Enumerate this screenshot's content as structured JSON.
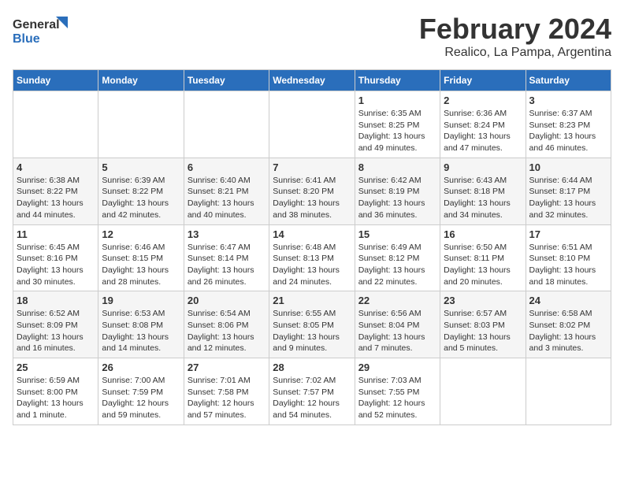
{
  "logo": {
    "line1": "General",
    "line2": "Blue"
  },
  "title": "February 2024",
  "subtitle": "Realico, La Pampa, Argentina",
  "weekdays": [
    "Sunday",
    "Monday",
    "Tuesday",
    "Wednesday",
    "Thursday",
    "Friday",
    "Saturday"
  ],
  "weeks": [
    [
      {
        "num": "",
        "info": ""
      },
      {
        "num": "",
        "info": ""
      },
      {
        "num": "",
        "info": ""
      },
      {
        "num": "",
        "info": ""
      },
      {
        "num": "1",
        "info": "Sunrise: 6:35 AM\nSunset: 8:25 PM\nDaylight: 13 hours\nand 49 minutes."
      },
      {
        "num": "2",
        "info": "Sunrise: 6:36 AM\nSunset: 8:24 PM\nDaylight: 13 hours\nand 47 minutes."
      },
      {
        "num": "3",
        "info": "Sunrise: 6:37 AM\nSunset: 8:23 PM\nDaylight: 13 hours\nand 46 minutes."
      }
    ],
    [
      {
        "num": "4",
        "info": "Sunrise: 6:38 AM\nSunset: 8:22 PM\nDaylight: 13 hours\nand 44 minutes."
      },
      {
        "num": "5",
        "info": "Sunrise: 6:39 AM\nSunset: 8:22 PM\nDaylight: 13 hours\nand 42 minutes."
      },
      {
        "num": "6",
        "info": "Sunrise: 6:40 AM\nSunset: 8:21 PM\nDaylight: 13 hours\nand 40 minutes."
      },
      {
        "num": "7",
        "info": "Sunrise: 6:41 AM\nSunset: 8:20 PM\nDaylight: 13 hours\nand 38 minutes."
      },
      {
        "num": "8",
        "info": "Sunrise: 6:42 AM\nSunset: 8:19 PM\nDaylight: 13 hours\nand 36 minutes."
      },
      {
        "num": "9",
        "info": "Sunrise: 6:43 AM\nSunset: 8:18 PM\nDaylight: 13 hours\nand 34 minutes."
      },
      {
        "num": "10",
        "info": "Sunrise: 6:44 AM\nSunset: 8:17 PM\nDaylight: 13 hours\nand 32 minutes."
      }
    ],
    [
      {
        "num": "11",
        "info": "Sunrise: 6:45 AM\nSunset: 8:16 PM\nDaylight: 13 hours\nand 30 minutes."
      },
      {
        "num": "12",
        "info": "Sunrise: 6:46 AM\nSunset: 8:15 PM\nDaylight: 13 hours\nand 28 minutes."
      },
      {
        "num": "13",
        "info": "Sunrise: 6:47 AM\nSunset: 8:14 PM\nDaylight: 13 hours\nand 26 minutes."
      },
      {
        "num": "14",
        "info": "Sunrise: 6:48 AM\nSunset: 8:13 PM\nDaylight: 13 hours\nand 24 minutes."
      },
      {
        "num": "15",
        "info": "Sunrise: 6:49 AM\nSunset: 8:12 PM\nDaylight: 13 hours\nand 22 minutes."
      },
      {
        "num": "16",
        "info": "Sunrise: 6:50 AM\nSunset: 8:11 PM\nDaylight: 13 hours\nand 20 minutes."
      },
      {
        "num": "17",
        "info": "Sunrise: 6:51 AM\nSunset: 8:10 PM\nDaylight: 13 hours\nand 18 minutes."
      }
    ],
    [
      {
        "num": "18",
        "info": "Sunrise: 6:52 AM\nSunset: 8:09 PM\nDaylight: 13 hours\nand 16 minutes."
      },
      {
        "num": "19",
        "info": "Sunrise: 6:53 AM\nSunset: 8:08 PM\nDaylight: 13 hours\nand 14 minutes."
      },
      {
        "num": "20",
        "info": "Sunrise: 6:54 AM\nSunset: 8:06 PM\nDaylight: 13 hours\nand 12 minutes."
      },
      {
        "num": "21",
        "info": "Sunrise: 6:55 AM\nSunset: 8:05 PM\nDaylight: 13 hours\nand 9 minutes."
      },
      {
        "num": "22",
        "info": "Sunrise: 6:56 AM\nSunset: 8:04 PM\nDaylight: 13 hours\nand 7 minutes."
      },
      {
        "num": "23",
        "info": "Sunrise: 6:57 AM\nSunset: 8:03 PM\nDaylight: 13 hours\nand 5 minutes."
      },
      {
        "num": "24",
        "info": "Sunrise: 6:58 AM\nSunset: 8:02 PM\nDaylight: 13 hours\nand 3 minutes."
      }
    ],
    [
      {
        "num": "25",
        "info": "Sunrise: 6:59 AM\nSunset: 8:00 PM\nDaylight: 13 hours\nand 1 minute."
      },
      {
        "num": "26",
        "info": "Sunrise: 7:00 AM\nSunset: 7:59 PM\nDaylight: 12 hours\nand 59 minutes."
      },
      {
        "num": "27",
        "info": "Sunrise: 7:01 AM\nSunset: 7:58 PM\nDaylight: 12 hours\nand 57 minutes."
      },
      {
        "num": "28",
        "info": "Sunrise: 7:02 AM\nSunset: 7:57 PM\nDaylight: 12 hours\nand 54 minutes."
      },
      {
        "num": "29",
        "info": "Sunrise: 7:03 AM\nSunset: 7:55 PM\nDaylight: 12 hours\nand 52 minutes."
      },
      {
        "num": "",
        "info": ""
      },
      {
        "num": "",
        "info": ""
      }
    ]
  ]
}
